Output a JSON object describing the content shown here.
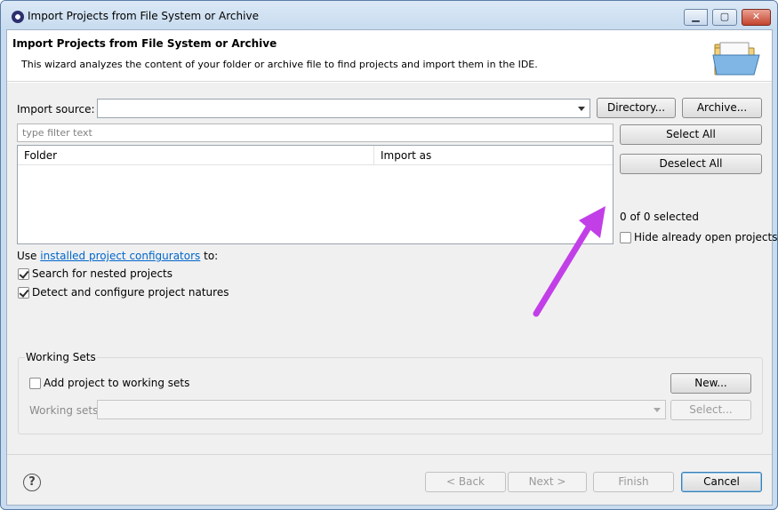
{
  "window": {
    "title": "Import Projects from File System or Archive"
  },
  "header": {
    "title": "Import Projects from File System or Archive",
    "description": "This wizard analyzes the content of your folder or archive file to find projects and import them in the IDE.",
    "icon": "open-folder-icon"
  },
  "source": {
    "label": "Import source:",
    "value": "",
    "directory_button": "Directory...",
    "archive_button": "Archive..."
  },
  "filter": {
    "placeholder": "type filter text"
  },
  "table": {
    "columns": [
      "Folder",
      "Import as"
    ],
    "rows": []
  },
  "side": {
    "select_all": "Select All",
    "deselect_all": "Deselect All",
    "selected_count": "0 of 0 selected",
    "hide_open_label": "Hide already open projects",
    "hide_open_checked": false
  },
  "configurators": {
    "prefix": "Use",
    "link_text": "installed project configurators",
    "suffix": "to:",
    "search_nested_label": "Search for nested projects",
    "search_nested_checked": true,
    "detect_natures_label": "Detect and configure project natures",
    "detect_natures_checked": true
  },
  "working_sets": {
    "title": "Working Sets",
    "add_label": "Add project to working sets",
    "add_checked": false,
    "new_button": "New...",
    "sets_label": "Working sets:",
    "select_button": "Select..."
  },
  "footer": {
    "help_icon": "help-icon",
    "back": "< Back",
    "next": "Next >",
    "finish": "Finish",
    "cancel": "Cancel"
  },
  "annotation": {
    "arrow_color": "#c23fe8"
  }
}
